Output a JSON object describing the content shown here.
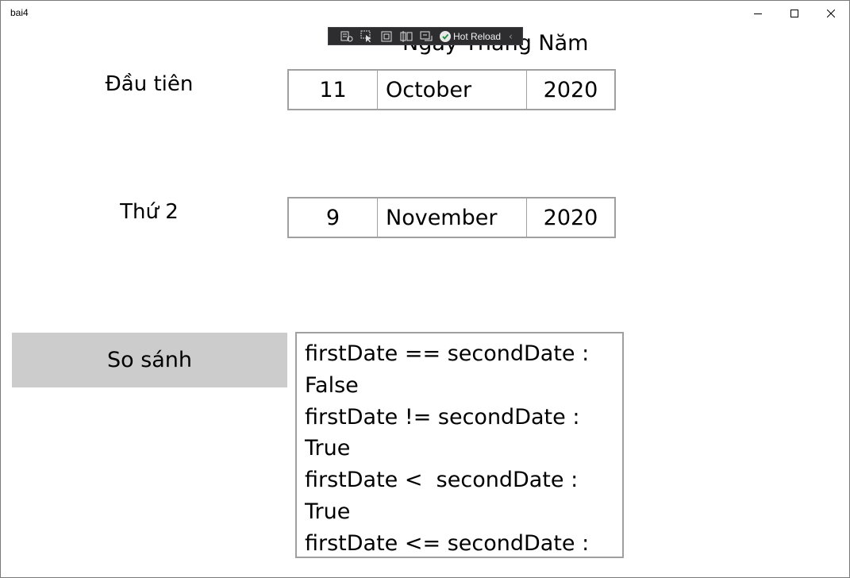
{
  "window": {
    "title": "bai4"
  },
  "debug_toolbar": {
    "icons": [
      "live-visual-tree-icon",
      "select-element-icon",
      "display-layout-adorners-icon",
      "track-focus-icon",
      "binding-failures-icon"
    ],
    "hot_reload_label": "Hot Reload",
    "collapse_glyph": "‹"
  },
  "header": {
    "label": "Ngày Tháng Năm"
  },
  "first": {
    "label": "Đầu tiên",
    "day": "11",
    "month": "October",
    "year": "2020"
  },
  "second": {
    "label": "Thứ 2",
    "day": "9",
    "month": "November",
    "year": "2020"
  },
  "compare": {
    "button_label": "So sánh"
  },
  "result": {
    "text": "firstDate == secondDate : False\nfirstDate != secondDate : True\nfirstDate <  secondDate : True\nfirstDate <= secondDate : True\nfirstDate >  secondDate :"
  }
}
